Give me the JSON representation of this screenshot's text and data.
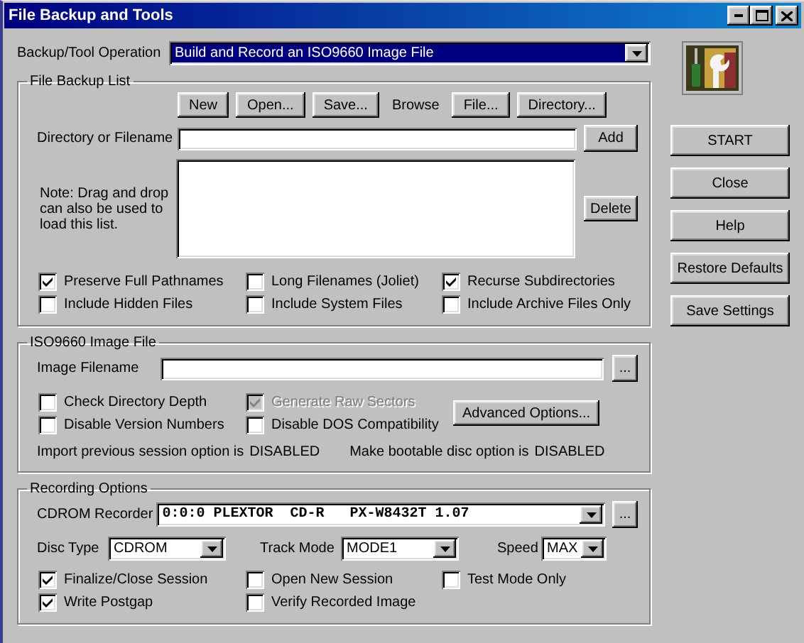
{
  "window": {
    "title": "File Backup and Tools"
  },
  "operation": {
    "label": "Backup/Tool Operation",
    "value": "Build and Record an ISO9660 Image File",
    "highlighted": true
  },
  "file_backup_list": {
    "title": "File Backup List",
    "toolbar": [
      {
        "kind": "button",
        "label": "New"
      },
      {
        "kind": "button",
        "label": "Open..."
      },
      {
        "kind": "button",
        "label": "Save..."
      },
      {
        "kind": "label",
        "label": "Browse"
      },
      {
        "kind": "button",
        "label": "File..."
      },
      {
        "kind": "button",
        "label": "Directory..."
      }
    ],
    "path_field": {
      "label": "Directory or Filename"
    },
    "add_button": "Add",
    "note": "Note: Drag and drop can also be used to load this list.",
    "delete_button": "Delete",
    "options": [
      {
        "label": "Preserve Full Pathnames",
        "checked": true,
        "disabled": false
      },
      {
        "label": "Long Filenames (Joliet)",
        "checked": false,
        "disabled": false
      },
      {
        "label": "Recurse Subdirectories",
        "checked": true,
        "disabled": false
      },
      {
        "label": "Include Hidden Files",
        "checked": false,
        "disabled": false
      },
      {
        "label": "Include System Files",
        "checked": false,
        "disabled": false
      },
      {
        "label": "Include Archive Files Only",
        "checked": false,
        "disabled": false
      }
    ]
  },
  "iso_image": {
    "title": "ISO9660 Image File",
    "field": {
      "label": "Image Filename"
    },
    "browse_button": "...",
    "options": [
      {
        "label": "Check Directory Depth",
        "checked": false,
        "disabled": false
      },
      {
        "label": "Generate Raw Sectors",
        "checked": true,
        "disabled": true
      },
      {
        "label": "Disable Version Numbers",
        "checked": false,
        "disabled": false
      },
      {
        "label": "Disable DOS Compatibility",
        "checked": false,
        "disabled": false
      }
    ],
    "advanced_button": "Advanced Options...",
    "status": [
      {
        "label": "Import previous session option is",
        "value": "DISABLED"
      },
      {
        "label": "Make bootable disc option is",
        "value": "DISABLED"
      }
    ]
  },
  "recording": {
    "title": "Recording Options",
    "recorder": {
      "label": "CDROM Recorder",
      "value": "0:0:0 PLEXTOR  CD-R   PX-W8432T 1.07"
    },
    "recorder_button": "...",
    "selects": [
      {
        "label": "Disc Type",
        "value": "CDROM"
      },
      {
        "label": "Track Mode",
        "value": "MODE1"
      },
      {
        "label": "Speed",
        "value": "MAX"
      }
    ],
    "options": [
      {
        "label": "Finalize/Close Session",
        "checked": true,
        "disabled": false
      },
      {
        "label": "Open New Session",
        "checked": false,
        "disabled": false
      },
      {
        "label": "Test Mode Only",
        "checked": false,
        "disabled": false
      },
      {
        "label": "Write Postgap",
        "checked": true,
        "disabled": false
      },
      {
        "label": "Verify Recorded Image",
        "checked": false,
        "disabled": false
      }
    ]
  },
  "side_buttons": [
    "START",
    "Close",
    "Help",
    "Restore Defaults",
    "Save Settings"
  ]
}
